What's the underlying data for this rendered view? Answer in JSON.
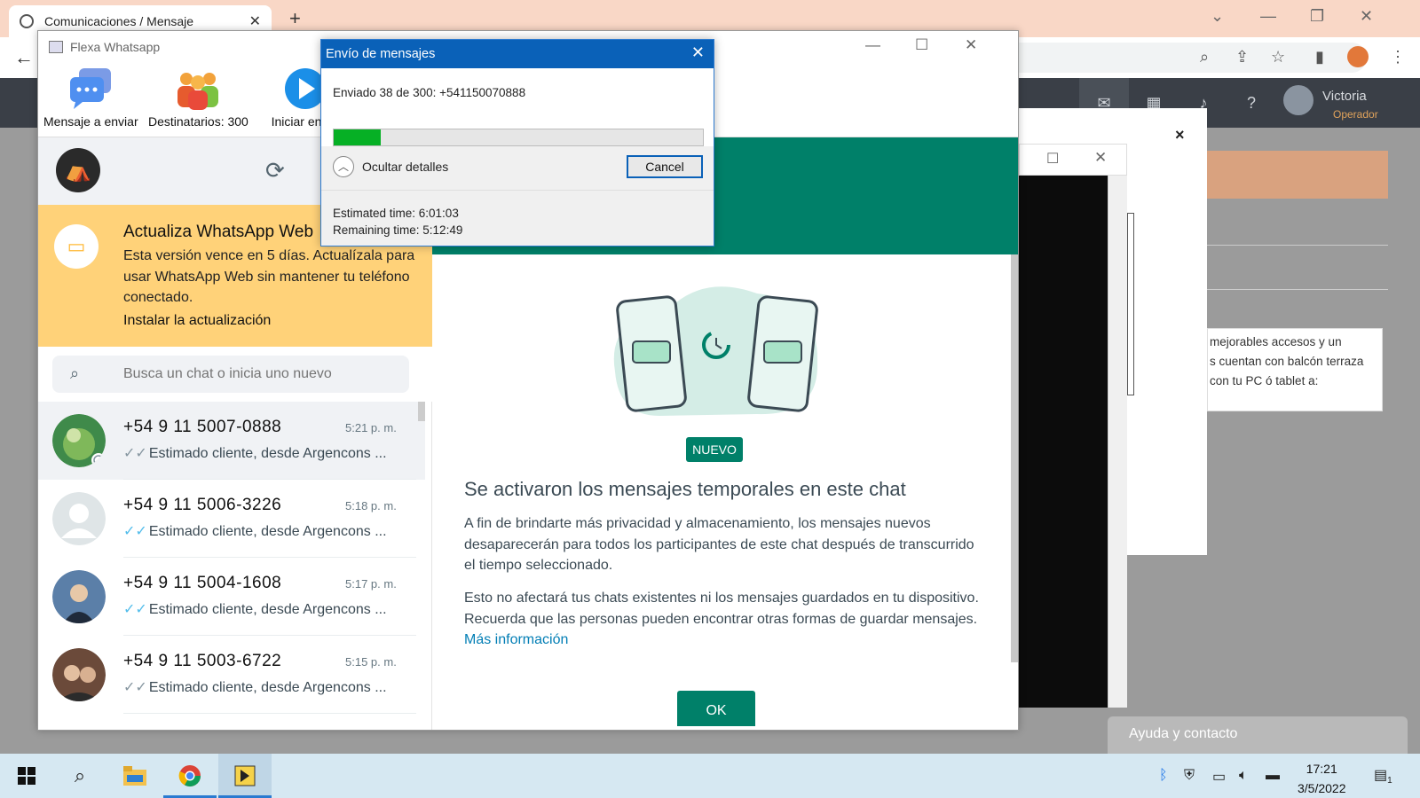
{
  "browser": {
    "tab_title": "Comunicaciones / Mensaje",
    "tab_close": "✕",
    "new_tab": "+"
  },
  "web_app": {
    "user_name": "Victoria",
    "user_role": "Operador",
    "close_glyph": "×",
    "text_lines": [
      "mejorables accesos y un",
      "s cuentan con balcón terraza",
      "con tu PC ó tablet a:"
    ],
    "help_label": "Ayuda y contacto"
  },
  "flexa": {
    "title": "Flexa Whatsapp",
    "ribbon": {
      "message_label": "Mensaje a enviar",
      "recipients_label": "Destinatarios: 300",
      "start_label": "Iniciar en"
    }
  },
  "whatsapp": {
    "banner": {
      "title": "Actualiza WhatsApp Web",
      "text": "Esta versión vence en 5 días. Actualízala para usar WhatsApp Web sin mantener tu teléfono conectado.",
      "link": "Instalar la actualización"
    },
    "search_placeholder": "Busca un chat o inicia uno nuevo",
    "chats": [
      {
        "name": "+54 9 11 5007-0888",
        "time": "5:21 p. m.",
        "preview": "Estimado cliente, desde Argencons ...",
        "read": false
      },
      {
        "name": "+54 9 11 5006-3226",
        "time": "5:18 p. m.",
        "preview": "Estimado cliente, desde Argencons ...",
        "read": true
      },
      {
        "name": "+54 9 11 5004-1608",
        "time": "5:17 p. m.",
        "preview": "Estimado cliente, desde Argencons ...",
        "read": true
      },
      {
        "name": "+54 9 11 5003-6722",
        "time": "5:15 p. m.",
        "preview": "Estimado cliente, desde Argencons ...",
        "read": false
      }
    ],
    "main": {
      "badge": "NUEVO",
      "title": "Se activaron los mensajes temporales en este chat",
      "para1": "A fin de brindarte más privacidad y almacenamiento, los mensajes nuevos desaparecerán para todos los participantes de este chat después de transcurrido el tiempo seleccionado.",
      "para2": "Esto no afectará tus chats existentes ni los mensajes guardados en tu dispositivo. Recuerda que las personas pueden encontrar otras formas de guardar mensajes.",
      "more_link": "Más información",
      "ok_label": "OK"
    }
  },
  "dialog": {
    "title": "Envío de mensajes",
    "status": "Enviado 38 de 300: +541150070888",
    "progress_fraction": 0.1267,
    "toggle_label": "Ocultar detalles",
    "cancel_label": "Cancel",
    "estimated": "Estimated time: 6:01:03",
    "remaining": "Remaining time: 5:12:49"
  },
  "taskbar": {
    "time": "17:21",
    "date": "3/5/2022",
    "notif_count": "1"
  }
}
